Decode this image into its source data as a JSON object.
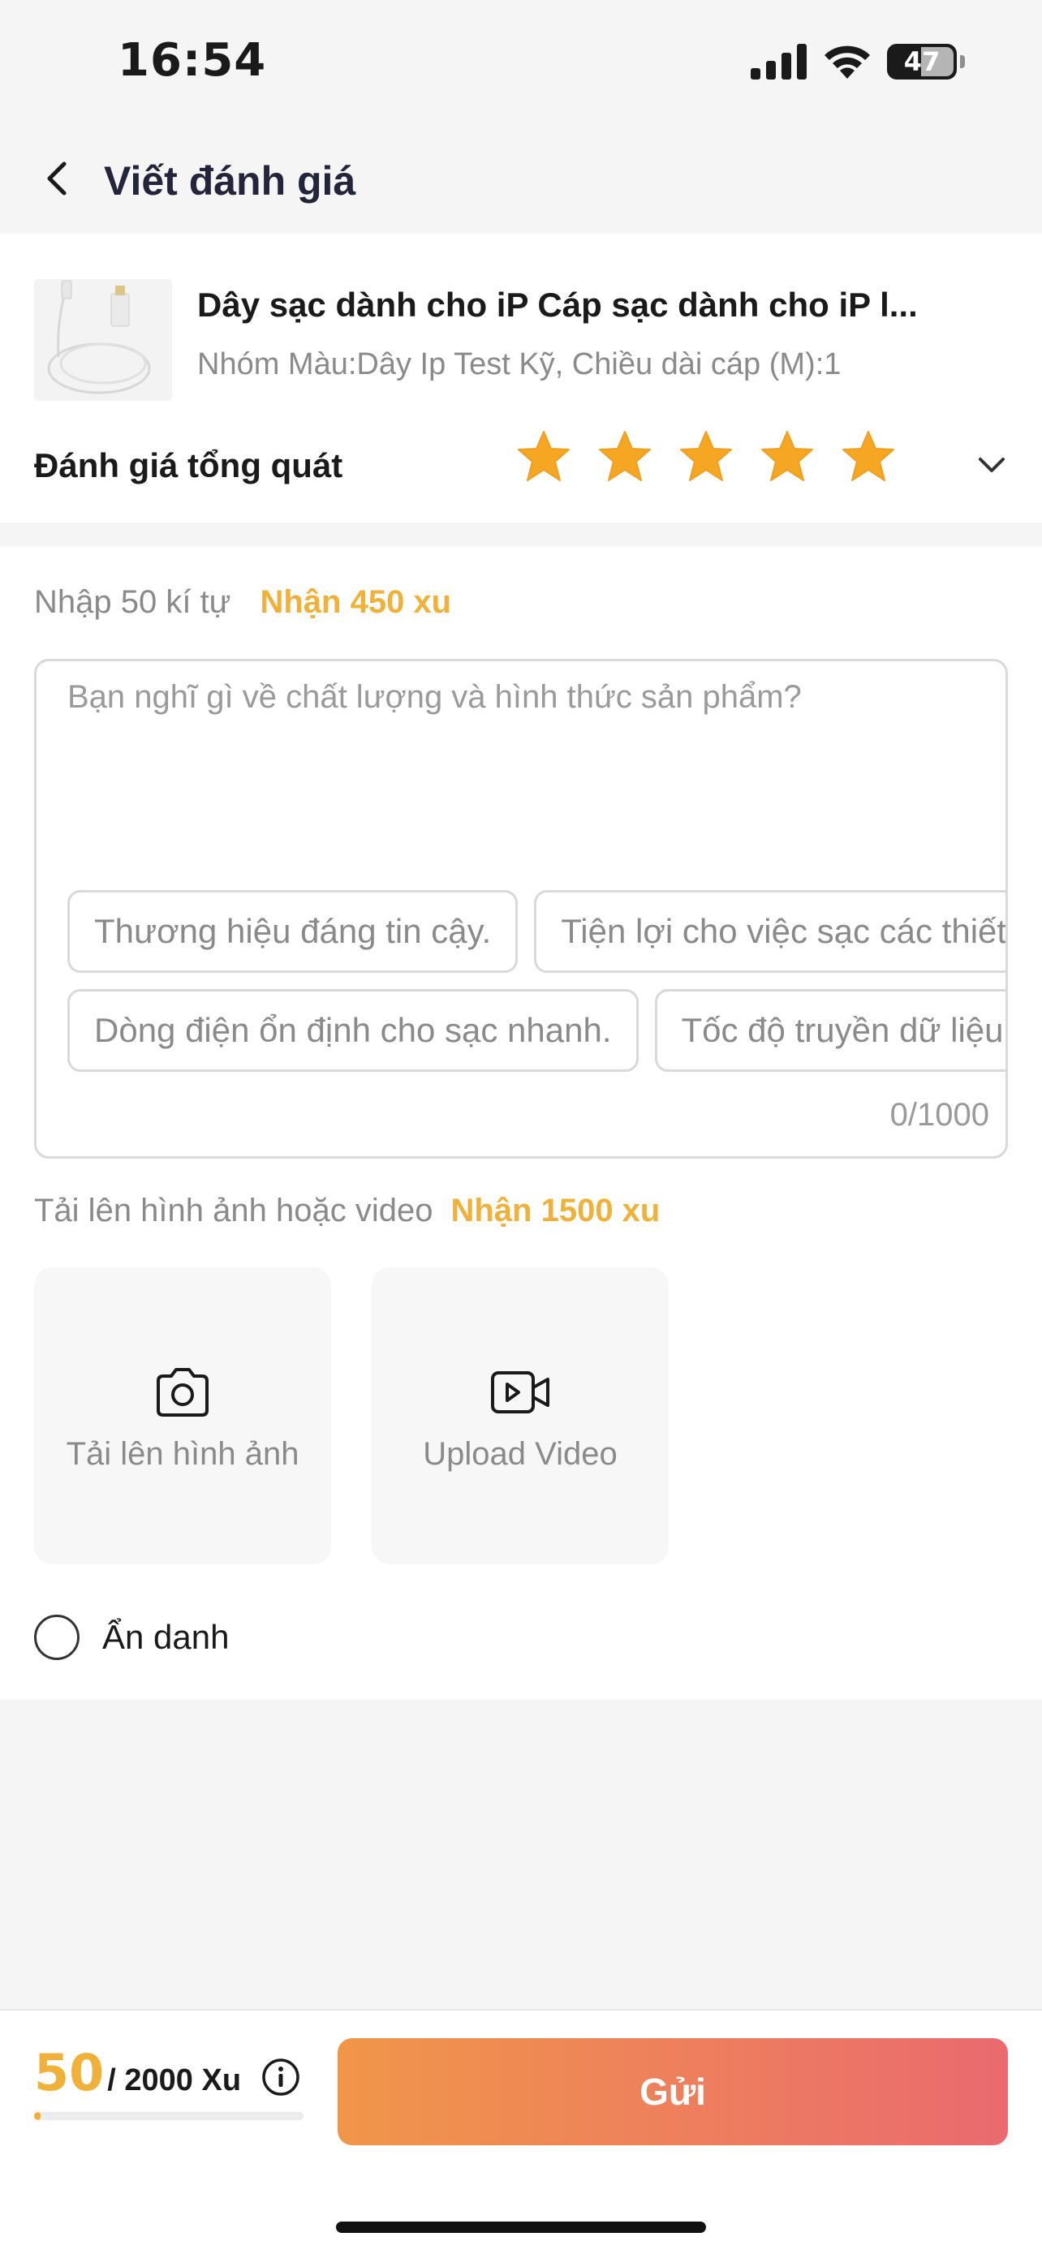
{
  "status_bar": {
    "time": "16:54",
    "battery": "47",
    "icons": [
      "signal-icon",
      "wifi-icon",
      "battery-icon"
    ]
  },
  "header": {
    "title": "Viết đánh giá",
    "back_icon": "chevron-left-icon"
  },
  "product": {
    "name": "Dây sạc dành cho iP Cáp sạc dành cho iP l...",
    "variant": "Nhóm Màu:Dây Ip Test Kỹ, Chiều dài cáp (M):1",
    "rating_label": "Đánh giá tổng quát",
    "rating": 5,
    "rating_max": 5
  },
  "review": {
    "hint_prefix": "Nhập 50 kí tự",
    "hint_reward": "Nhận 450 xu",
    "placeholder": "Bạn nghĩ gì về chất lượng và hình thức sản phẩm?",
    "suggestions_row1": [
      "Thương hiệu đáng tin cậy.",
      "Tiện lợi cho việc sạc các thiết bị."
    ],
    "suggestions_row2": [
      "Dòng điện ổn định cho sạc nhanh.",
      "Tốc độ truyền dữ liệu nhanh."
    ],
    "counter": "0/1000"
  },
  "upload": {
    "hint_prefix": "Tải lên hình ảnh hoặc video",
    "hint_reward": "Nhận 1500 xu",
    "photo_label": "Tải lên hình ảnh",
    "video_label": "Upload Video"
  },
  "anonymous": {
    "label": "Ẩn danh",
    "checked": false
  },
  "footer": {
    "xu_current": "50",
    "xu_total": "/ 2000 Xu",
    "xu_progress": 0.025,
    "submit_label": "Gửi"
  },
  "colors": {
    "accent_orange": "#efb13a",
    "button_start": "#f19649",
    "button_end": "#ea6a6f",
    "star": "#f5a623"
  }
}
